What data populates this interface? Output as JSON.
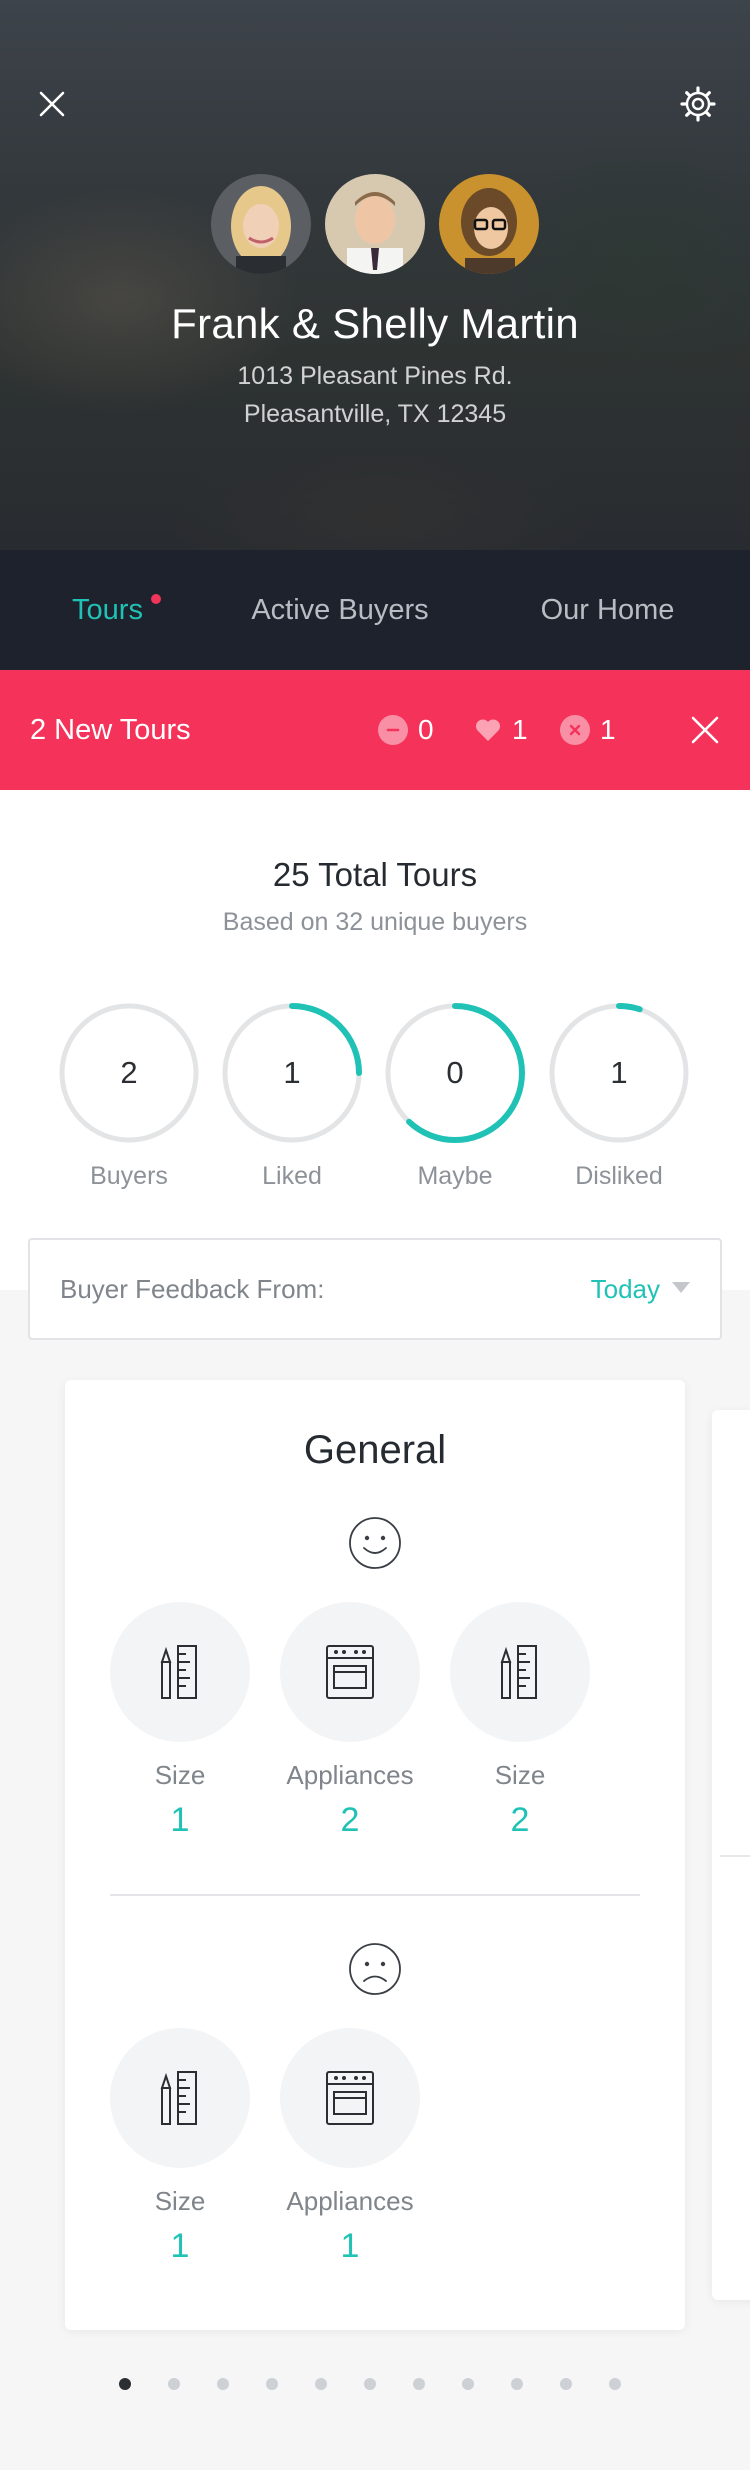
{
  "profile": {
    "name": "Frank & Shelly Martin",
    "address_line1": "1013 Pleasant Pines Rd.",
    "address_line2": "Pleasantville, TX 12345"
  },
  "tabs": [
    {
      "label": "Tours",
      "active": true,
      "has_notification": true
    },
    {
      "label": "Active Buyers",
      "active": false
    },
    {
      "label": "Our Home",
      "active": false
    }
  ],
  "banner": {
    "title": "2 New Tours",
    "maybe_count": "0",
    "liked_count": "1",
    "disliked_count": "1",
    "color": "#f5335a"
  },
  "summary": {
    "title": "25 Total Tours",
    "subtitle": "Based on 32 unique buyers",
    "rings": [
      {
        "label": "Buyers",
        "value": "2",
        "progress": 0
      },
      {
        "label": "Liked",
        "value": "1",
        "progress": 0.25
      },
      {
        "label": "Maybe",
        "value": "0",
        "progress": 0.62
      },
      {
        "label": "Disliked",
        "value": "1",
        "progress": 0.05
      }
    ],
    "accent": "#21c2b6"
  },
  "feedback": {
    "label": "Buyer Feedback From:",
    "value": "Today"
  },
  "card": {
    "title": "General",
    "positive": [
      {
        "name": "Size",
        "count": "1",
        "icon": "pencil-ruler-icon"
      },
      {
        "name": "Appliances",
        "count": "2",
        "icon": "oven-icon"
      },
      {
        "name": "Size",
        "count": "2",
        "icon": "pencil-ruler-icon"
      }
    ],
    "negative": [
      {
        "name": "Size",
        "count": "1",
        "icon": "pencil-ruler-icon"
      },
      {
        "name": "Appliances",
        "count": "1",
        "icon": "oven-icon"
      }
    ]
  },
  "pager": {
    "total": 11,
    "active_index": 0
  }
}
